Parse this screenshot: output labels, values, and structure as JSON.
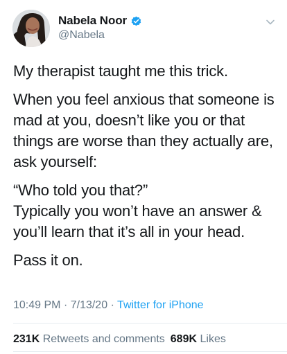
{
  "author": {
    "display_name": "Nabela Noor",
    "handle": "@Nabela",
    "verified": true
  },
  "tweet": {
    "paragraphs": [
      "My therapist taught me this trick.",
      "When you feel anxious that someone is mad at you, doesn’t like you or that things are worse than they actually are, ask yourself:",
      "“Who told you that?”",
      "Typically you won’t have an answer & you’ll learn that it’s all in your head.",
      "Pass it on."
    ]
  },
  "meta": {
    "time": "10:49 PM",
    "separator": "·",
    "date": "7/13/20",
    "source": "Twitter for iPhone"
  },
  "stats": {
    "retweets_count": "231K",
    "retweets_label": "Retweets and comments",
    "likes_count": "689K",
    "likes_label": "Likes"
  },
  "colors": {
    "accent": "#1da1f2",
    "secondary_text": "#657786",
    "primary_text": "#14171a",
    "divider": "#e6ecf0"
  },
  "icons": {
    "verified": "verified-badge-icon",
    "menu": "chevron-down-icon"
  }
}
